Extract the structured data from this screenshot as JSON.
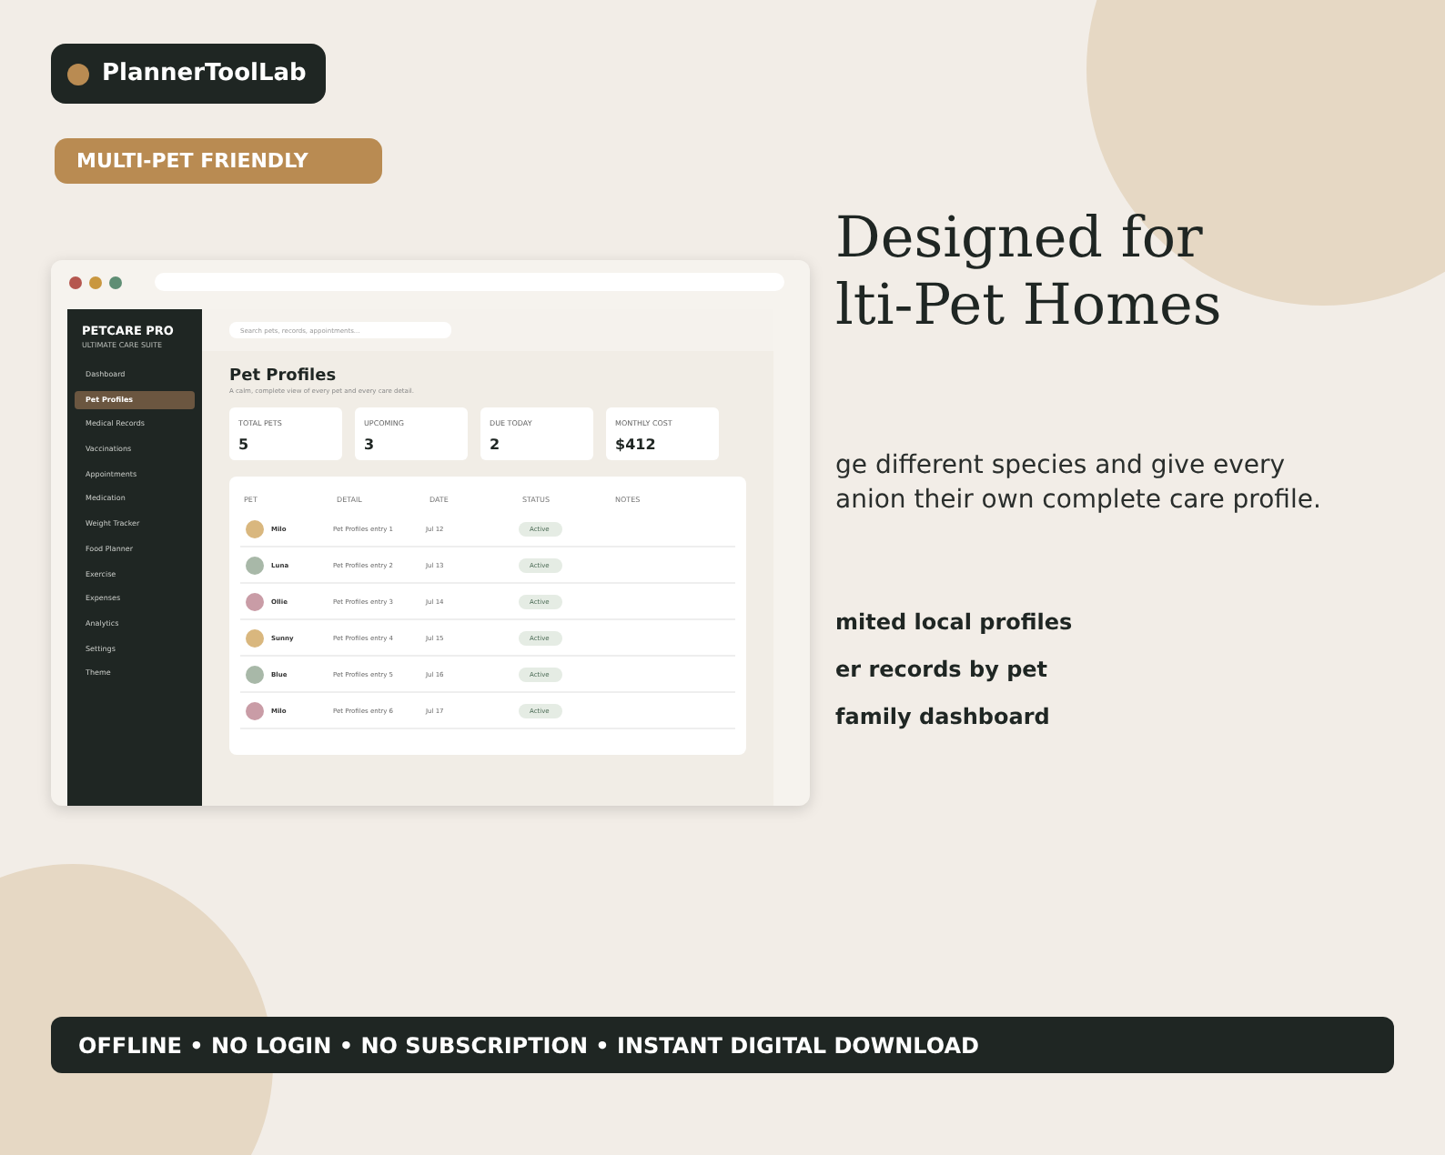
{
  "brand": {
    "name": "PlannerToolLab"
  },
  "badge": "MULTI-PET FRIENDLY",
  "mockup": {
    "app_title": "PETCARE PRO",
    "app_subtitle": "ULTIMATE CARE SUITE",
    "sidebar": {
      "items": [
        {
          "label": "Dashboard",
          "selected": false
        },
        {
          "label": "Pet Profiles",
          "selected": true
        },
        {
          "label": "Medical Records",
          "selected": false
        },
        {
          "label": "Vaccinations",
          "selected": false
        },
        {
          "label": "Appointments",
          "selected": false
        },
        {
          "label": "Medication",
          "selected": false
        },
        {
          "label": "Weight Tracker",
          "selected": false
        },
        {
          "label": "Food Planner",
          "selected": false
        },
        {
          "label": "Exercise",
          "selected": false
        },
        {
          "label": "Expenses",
          "selected": false
        },
        {
          "label": "Analytics",
          "selected": false
        },
        {
          "label": "Settings",
          "selected": false
        },
        {
          "label": "Theme",
          "selected": false
        }
      ]
    },
    "search": {
      "placeholder": "Search pets, records, appointments..."
    },
    "page_title": "Pet Profiles",
    "page_subtitle": "A calm, complete view of every pet and every care detail.",
    "stats": [
      {
        "label": "TOTAL PETS",
        "value": "5"
      },
      {
        "label": "UPCOMING",
        "value": "3"
      },
      {
        "label": "DUE TODAY",
        "value": "2"
      },
      {
        "label": "MONTHLY COST",
        "value": "$412"
      }
    ],
    "table": {
      "columns": [
        "PET",
        "DETAIL",
        "DATE",
        "STATUS",
        "NOTES"
      ],
      "rows": [
        {
          "pet": "Milo",
          "color": "#d9b77e",
          "detail": "Pet Profiles entry 1",
          "date": "Jul 12",
          "status": "Active"
        },
        {
          "pet": "Luna",
          "color": "#a8b8a8",
          "detail": "Pet Profiles entry 2",
          "date": "Jul 13",
          "status": "Active"
        },
        {
          "pet": "Ollie",
          "color": "#c99ca6",
          "detail": "Pet Profiles entry 3",
          "date": "Jul 14",
          "status": "Active"
        },
        {
          "pet": "Sunny",
          "color": "#d9b77e",
          "detail": "Pet Profiles entry 4",
          "date": "Jul 15",
          "status": "Active"
        },
        {
          "pet": "Blue",
          "color": "#a8b8a8",
          "detail": "Pet Profiles entry 5",
          "date": "Jul 16",
          "status": "Active"
        },
        {
          "pet": "Milo",
          "color": "#c99ca6",
          "detail": "Pet Profiles entry 6",
          "date": "Jul 17",
          "status": "Active"
        }
      ]
    }
  },
  "headline": [
    "Designed for",
    "lti-Pet Homes"
  ],
  "description": [
    "ge different species and give every",
    "anion their own complete care profile."
  ],
  "features": [
    "mited local profiles",
    "er records by pet",
    "family dashboard"
  ],
  "footer_banner": "OFFLINE • NO LOGIN • NO SUBSCRIPTION • INSTANT DIGITAL DOWNLOAD"
}
